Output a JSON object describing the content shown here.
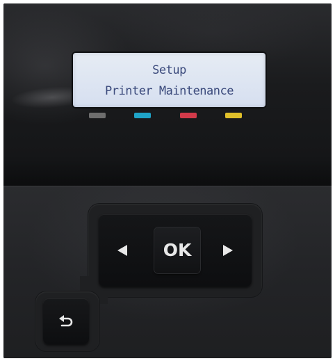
{
  "screen": {
    "line1": "Setup",
    "line2": "Printer Maintenance"
  },
  "indicators": [
    {
      "name": "black-ink-indicator",
      "color": "#6e6e6e"
    },
    {
      "name": "cyan-ink-indicator",
      "color": "#1fa4c8"
    },
    {
      "name": "magenta-ink-indicator",
      "color": "#d23a4a"
    },
    {
      "name": "yellow-ink-indicator",
      "color": "#e0c02a"
    }
  ],
  "controls": {
    "ok_label": "OK",
    "left_icon": "left-arrow-icon",
    "right_icon": "right-arrow-icon",
    "back_icon": "back-arrow-icon"
  },
  "colors": {
    "lcd_background": "#dde4f2",
    "lcd_text": "#3b4a7c",
    "panel": "#1c1d1f",
    "button_glyph": "#e8e8e8"
  }
}
